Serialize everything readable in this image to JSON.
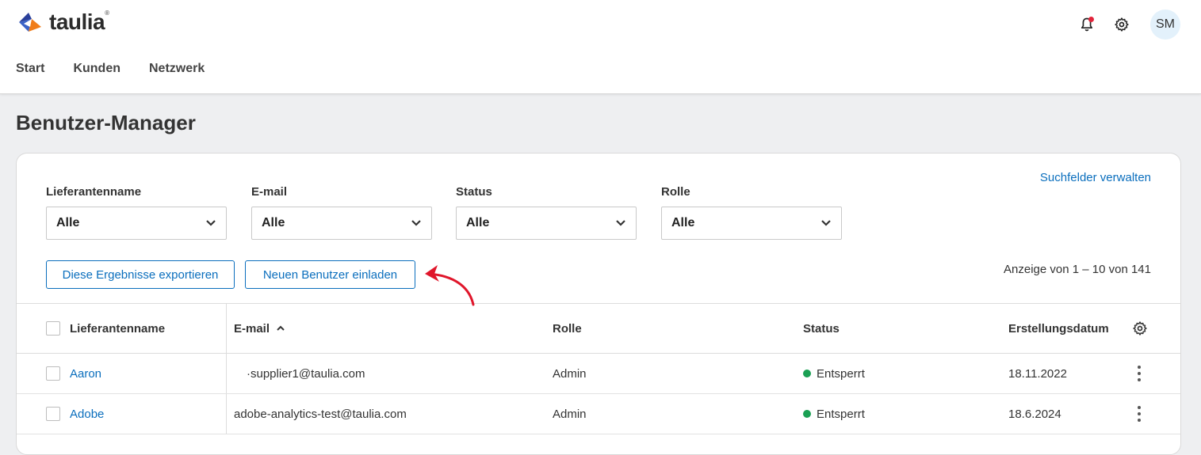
{
  "brand": {
    "name": "taulia",
    "tm": "®"
  },
  "nav": [
    {
      "label": "Start"
    },
    {
      "label": "Kunden"
    },
    {
      "label": "Netzwerk"
    }
  ],
  "user": {
    "initials": "SM"
  },
  "page": {
    "title": "Benutzer-Manager"
  },
  "filters": {
    "manage_link": "Suchfelder verwalten",
    "items": [
      {
        "label": "Lieferantenname",
        "value": "Alle"
      },
      {
        "label": "E-mail",
        "value": "Alle"
      },
      {
        "label": "Status",
        "value": "Alle"
      },
      {
        "label": "Rolle",
        "value": "Alle"
      }
    ]
  },
  "actions": {
    "export_label": "Diese Ergebnisse exportieren",
    "invite_label": "Neuen Benutzer einladen",
    "count_text": "Anzeige von 1 – 10 von 141"
  },
  "table": {
    "headers": {
      "supplier": "Lieferantenname",
      "email": "E-mail",
      "role": "Rolle",
      "status": "Status",
      "created": "Erstellungsdatum"
    },
    "sort_indicator": "▲",
    "rows": [
      {
        "supplier": "Aaron",
        "email": "·supplier1@taulia.com",
        "role": "Admin",
        "status": "Entsperrt",
        "created": "18.11.2022"
      },
      {
        "supplier": "Adobe",
        "email": "adobe-analytics-test@taulia.com",
        "role": "Admin",
        "status": "Entsperrt",
        "created": "18.6.2024"
      }
    ]
  },
  "colors": {
    "accent": "#0a6ebd",
    "status_ok": "#1aa053",
    "notification": "#e2243b",
    "annotation_arrow": "#e0162b"
  }
}
